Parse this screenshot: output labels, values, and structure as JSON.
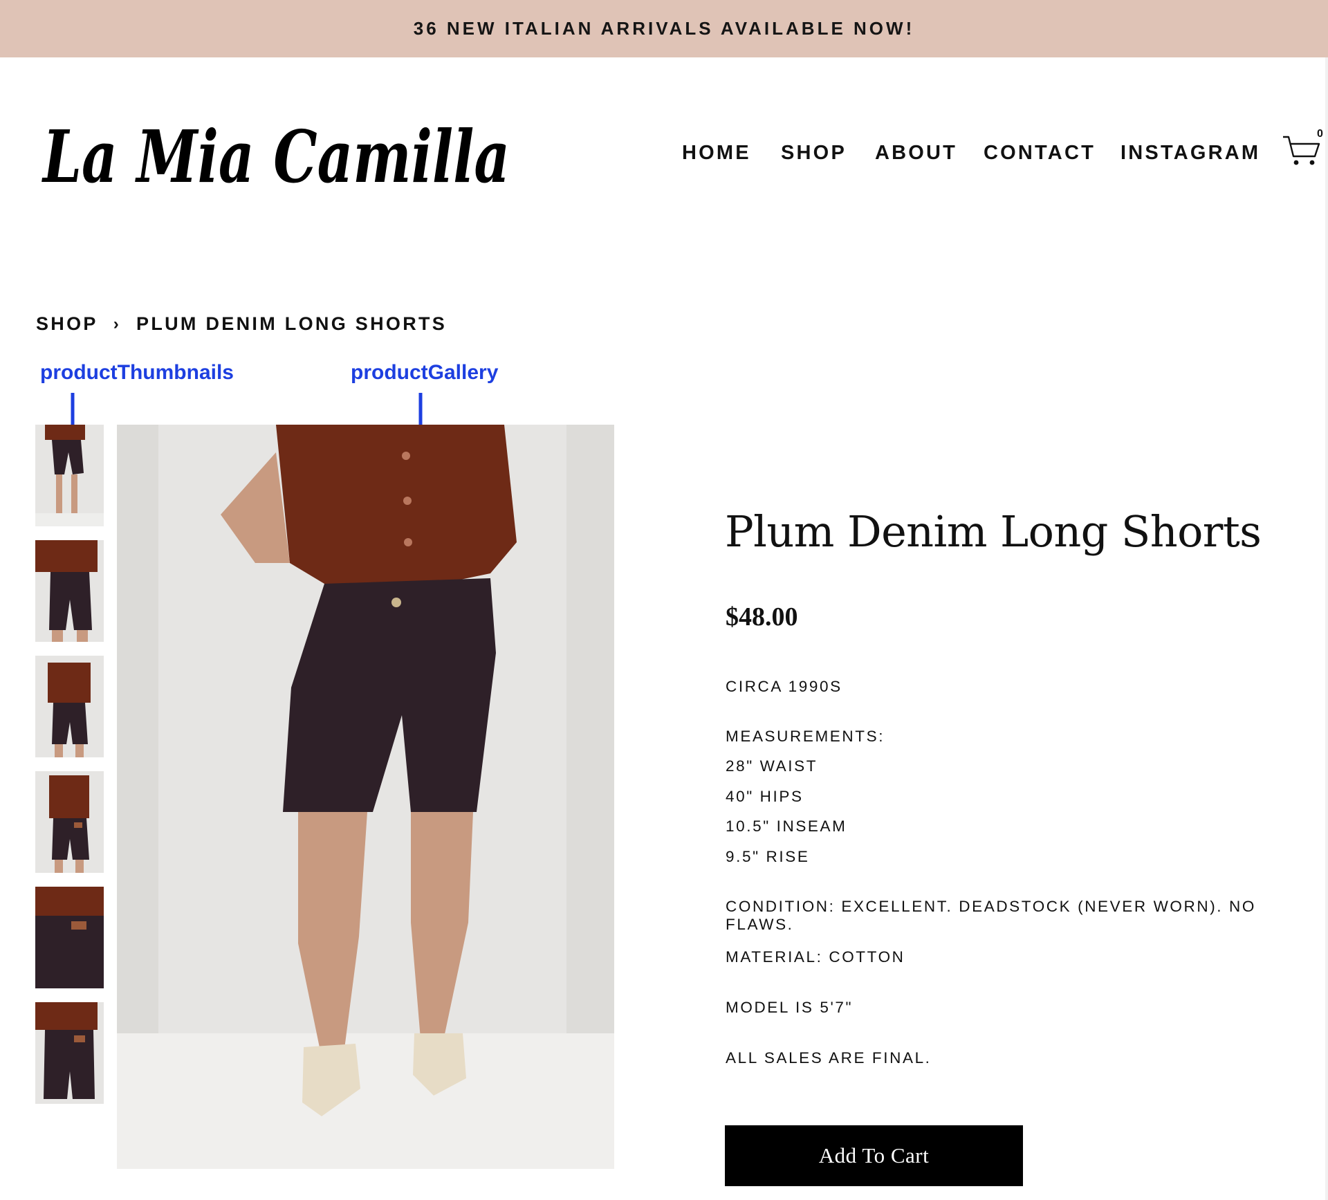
{
  "announcement": "36 NEW ITALIAN ARRIVALS AVAILABLE NOW!",
  "brand": {
    "logo_text": "La Mia Camilla"
  },
  "nav": {
    "items": [
      "HOME",
      "SHOP",
      "ABOUT",
      "CONTACT",
      "INSTAGRAM"
    ],
    "cart_count": "0",
    "cart_icon": "cart-icon"
  },
  "breadcrumb": {
    "shop": "SHOP",
    "separator": "›",
    "current": "PLUM DENIM LONG SHORTS"
  },
  "annotations": {
    "thumbnails_label": "productThumbnails",
    "gallery_label": "productGallery",
    "color": "#1d3fe0"
  },
  "product": {
    "title": "Plum Denim Long Shorts",
    "price": "$48.00",
    "era": "CIRCA 1990S",
    "measurements_heading": "MEASUREMENTS:",
    "measurements": [
      "28\" WAIST",
      "40\" HIPS",
      "10.5\" INSEAM",
      "9.5\"  RISE"
    ],
    "condition": "CONDITION: EXCELLENT. DEADSTOCK (NEVER WORN). NO FLAWS.",
    "material": "MATERIAL: COTTON",
    "model": "MODEL IS 5'7\"",
    "sales": "ALL SALES ARE FINAL.",
    "add_to_cart": "Add To Cart"
  },
  "colors": {
    "announcement_bg": "#dfc3b6",
    "shirt": "#6e2a16",
    "shorts": "#2e2028",
    "backdrop": "#e6e5e3",
    "button_bg": "#000000"
  }
}
